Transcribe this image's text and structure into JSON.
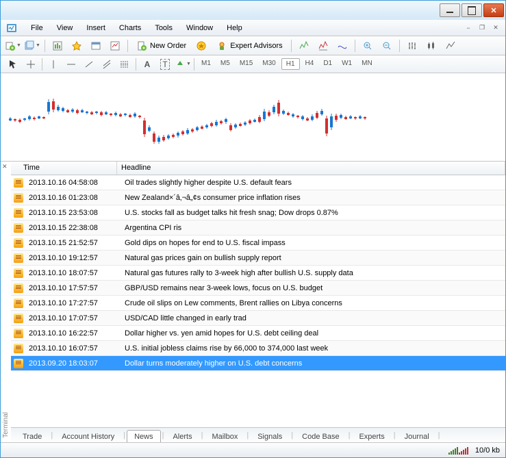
{
  "menu": {
    "items": [
      "File",
      "View",
      "Insert",
      "Charts",
      "Tools",
      "Window",
      "Help"
    ]
  },
  "toolbar": {
    "new_order": "New Order",
    "expert_advisors": "Expert Advisors"
  },
  "timeframes": [
    "M1",
    "M5",
    "M15",
    "M30",
    "H1",
    "H4",
    "D1",
    "W1",
    "MN"
  ],
  "active_timeframe": "H1",
  "news": {
    "col_time": "Time",
    "col_headline": "Headline",
    "rows": [
      {
        "time": "2013.10.16 04:58:08",
        "headline": "Oil trades slightly higher despite U.S. default fears"
      },
      {
        "time": "2013.10.16 01:23:08",
        "headline": "New Zealand×´â‚¬â„¢s consumer price inflation rises"
      },
      {
        "time": "2013.10.15 23:53:08",
        "headline": "U.S. stocks fall as budget talks hit fresh snag; Dow drops 0.87%"
      },
      {
        "time": "2013.10.15 22:38:08",
        "headline": "Argentina CPI ris"
      },
      {
        "time": "2013.10.15 21:52:57",
        "headline": "Gold dips on hopes for end to U.S. fiscal impass"
      },
      {
        "time": "2013.10.10 19:12:57",
        "headline": "Natural gas prices gain on bullish supply report"
      },
      {
        "time": "2013.10.10 18:07:57",
        "headline": "Natural gas futures rally to 3-week high after bullish U.S. supply data"
      },
      {
        "time": "2013.10.10 17:57:57",
        "headline": "GBP/USD remains near 3-week lows, focus on U.S. budget"
      },
      {
        "time": "2013.10.10 17:27:57",
        "headline": "Crude oil slips on Lew comments, Brent rallies on Libya concerns"
      },
      {
        "time": "2013.10.10 17:07:57",
        "headline": "USD/CAD little changed in early trad"
      },
      {
        "time": "2013.10.10 16:22:57",
        "headline": "Dollar higher vs. yen amid hopes for U.S. debt ceiling deal"
      },
      {
        "time": "2013.10.10 16:07:57",
        "headline": "U.S. initial jobless claims rise by 66,000 to 374,000 last week"
      },
      {
        "time": "2013.09.20 18:03:07",
        "headline": "Dollar turns moderately higher on U.S. debt concerns"
      }
    ],
    "selected_index": 12
  },
  "tabs": [
    "Trade",
    "Account History",
    "News",
    "Alerts",
    "Mailbox",
    "Signals",
    "Code Base",
    "Experts",
    "Journal"
  ],
  "active_tab": "News",
  "terminal_label": "Terminal",
  "status": {
    "bandwidth": "10/0 kb"
  },
  "chart_data": {
    "type": "candlestick",
    "note": "approximate candles read from screenshot; y-axis not labeled",
    "candles": [
      {
        "c": "blue",
        "y": 58,
        "w": 6,
        "b": 3
      },
      {
        "c": "red",
        "y": 59,
        "w": 5,
        "b": 2
      },
      {
        "c": "red",
        "y": 60,
        "w": 7,
        "b": 3
      },
      {
        "c": "blue",
        "y": 58,
        "w": 5,
        "b": 2
      },
      {
        "c": "blue",
        "y": 56,
        "w": 8,
        "b": 4
      },
      {
        "c": "red",
        "y": 57,
        "w": 6,
        "b": 2
      },
      {
        "c": "blue",
        "y": 55,
        "w": 5,
        "b": 3
      },
      {
        "c": "red",
        "y": 56,
        "w": 4,
        "b": 2
      },
      {
        "c": "blue",
        "y": 40,
        "w": 22,
        "b": 14
      },
      {
        "c": "red",
        "y": 38,
        "w": 20,
        "b": 12
      },
      {
        "c": "blue",
        "y": 42,
        "w": 10,
        "b": 5
      },
      {
        "c": "blue",
        "y": 44,
        "w": 8,
        "b": 4
      },
      {
        "c": "red",
        "y": 46,
        "w": 6,
        "b": 3
      },
      {
        "c": "blue",
        "y": 45,
        "w": 7,
        "b": 3
      },
      {
        "c": "red",
        "y": 47,
        "w": 8,
        "b": 4
      },
      {
        "c": "blue",
        "y": 46,
        "w": 6,
        "b": 3
      },
      {
        "c": "blue",
        "y": 48,
        "w": 5,
        "b": 2
      },
      {
        "c": "red",
        "y": 49,
        "w": 6,
        "b": 3
      },
      {
        "c": "blue",
        "y": 48,
        "w": 5,
        "b": 2
      },
      {
        "c": "red",
        "y": 50,
        "w": 8,
        "b": 4
      },
      {
        "c": "blue",
        "y": 49,
        "w": 6,
        "b": 3
      },
      {
        "c": "red",
        "y": 51,
        "w": 5,
        "b": 2
      },
      {
        "c": "blue",
        "y": 50,
        "w": 7,
        "b": 3
      },
      {
        "c": "red",
        "y": 52,
        "w": 6,
        "b": 3
      },
      {
        "c": "blue",
        "y": 51,
        "w": 5,
        "b": 2
      },
      {
        "c": "red",
        "y": 53,
        "w": 6,
        "b": 3
      },
      {
        "c": "blue",
        "y": 52,
        "w": 8,
        "b": 4
      },
      {
        "c": "red",
        "y": 54,
        "w": 5,
        "b": 2
      },
      {
        "c": "red",
        "y": 70,
        "w": 28,
        "b": 20
      },
      {
        "c": "blue",
        "y": 72,
        "w": 10,
        "b": 5
      },
      {
        "c": "red",
        "y": 85,
        "w": 18,
        "b": 12
      },
      {
        "c": "blue",
        "y": 88,
        "w": 12,
        "b": 6
      },
      {
        "c": "red",
        "y": 86,
        "w": 10,
        "b": 5
      },
      {
        "c": "blue",
        "y": 84,
        "w": 8,
        "b": 4
      },
      {
        "c": "red",
        "y": 82,
        "w": 7,
        "b": 3
      },
      {
        "c": "blue",
        "y": 80,
        "w": 9,
        "b": 4
      },
      {
        "c": "red",
        "y": 78,
        "w": 8,
        "b": 4
      },
      {
        "c": "blue",
        "y": 76,
        "w": 10,
        "b": 5
      },
      {
        "c": "red",
        "y": 74,
        "w": 7,
        "b": 3
      },
      {
        "c": "blue",
        "y": 72,
        "w": 8,
        "b": 4
      },
      {
        "c": "red",
        "y": 70,
        "w": 6,
        "b": 3
      },
      {
        "c": "blue",
        "y": 68,
        "w": 7,
        "b": 3
      },
      {
        "c": "red",
        "y": 66,
        "w": 8,
        "b": 4
      },
      {
        "c": "blue",
        "y": 64,
        "w": 10,
        "b": 5
      },
      {
        "c": "red",
        "y": 62,
        "w": 7,
        "b": 3
      },
      {
        "c": "blue",
        "y": 60,
        "w": 9,
        "b": 4
      },
      {
        "c": "red",
        "y": 70,
        "w": 12,
        "b": 7
      },
      {
        "c": "blue",
        "y": 68,
        "w": 8,
        "b": 4
      },
      {
        "c": "red",
        "y": 66,
        "w": 6,
        "b": 3
      },
      {
        "c": "blue",
        "y": 64,
        "w": 7,
        "b": 3
      },
      {
        "c": "red",
        "y": 62,
        "w": 8,
        "b": 4
      },
      {
        "c": "blue",
        "y": 60,
        "w": 6,
        "b": 3
      },
      {
        "c": "red",
        "y": 58,
        "w": 12,
        "b": 7
      },
      {
        "c": "blue",
        "y": 52,
        "w": 18,
        "b": 11
      },
      {
        "c": "red",
        "y": 50,
        "w": 10,
        "b": 5
      },
      {
        "c": "blue",
        "y": 44,
        "w": 14,
        "b": 8
      },
      {
        "c": "red",
        "y": 42,
        "w": 24,
        "b": 16
      },
      {
        "c": "blue",
        "y": 48,
        "w": 8,
        "b": 4
      },
      {
        "c": "red",
        "y": 50,
        "w": 6,
        "b": 3
      },
      {
        "c": "blue",
        "y": 52,
        "w": 7,
        "b": 3
      },
      {
        "c": "red",
        "y": 54,
        "w": 5,
        "b": 2
      },
      {
        "c": "blue",
        "y": 56,
        "w": 8,
        "b": 4
      },
      {
        "c": "red",
        "y": 58,
        "w": 6,
        "b": 3
      },
      {
        "c": "blue",
        "y": 56,
        "w": 10,
        "b": 5
      },
      {
        "c": "red",
        "y": 52,
        "w": 12,
        "b": 7
      },
      {
        "c": "blue",
        "y": 48,
        "w": 10,
        "b": 5
      },
      {
        "c": "red",
        "y": 68,
        "w": 30,
        "b": 22
      },
      {
        "c": "blue",
        "y": 62,
        "w": 24,
        "b": 16
      },
      {
        "c": "red",
        "y": 56,
        "w": 12,
        "b": 6
      },
      {
        "c": "blue",
        "y": 54,
        "w": 8,
        "b": 4
      },
      {
        "c": "red",
        "y": 56,
        "w": 6,
        "b": 3
      },
      {
        "c": "blue",
        "y": 55,
        "w": 6,
        "b": 3
      },
      {
        "c": "red",
        "y": 56,
        "w": 5,
        "b": 2
      },
      {
        "c": "blue",
        "y": 55,
        "w": 6,
        "b": 3
      },
      {
        "c": "red",
        "y": 56,
        "w": 5,
        "b": 2
      }
    ]
  }
}
